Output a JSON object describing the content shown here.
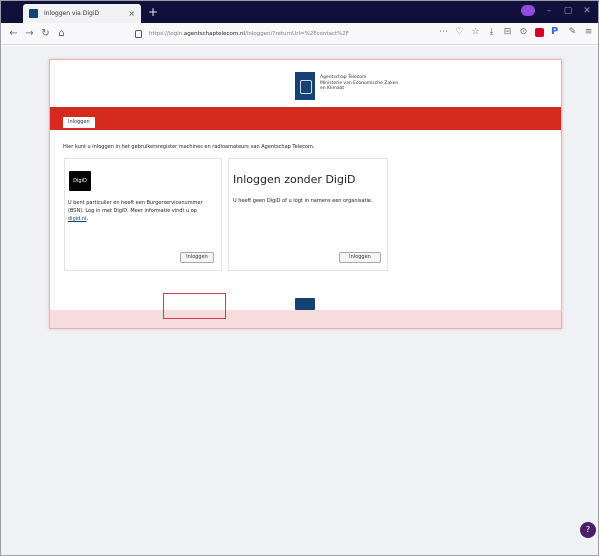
{
  "browser": {
    "tab_title": "Inloggen via DigiD",
    "tab_close": "×",
    "new_tab": "+",
    "url_prefix": "https://login.",
    "url_domain": "agentschaptelecom.nl",
    "url_path": "/inloggen/?returnUrl=%2Fcontact%2F",
    "nav": {
      "back": "←",
      "forward": "→",
      "reload": "↻",
      "home": "⌂"
    },
    "toolbar_icons": [
      "⋯",
      "♡",
      "☆",
      "⤓",
      "⊟",
      "⊙"
    ],
    "accent": "#8f4ddc"
  },
  "site": {
    "logo_text": "Agentschap Telecom\nMinisterie van Economische Zaken\nen Klimaat",
    "nav_tab": "Inloggen",
    "intro": "Hier kunt u inloggen in het gebruikersregister machines en radioamateurs van Agentschap Telecom.",
    "option1": {
      "logo": "DigiD",
      "description_before_link": "U bent particulier en heeft een Burgerservicenummer (BSN). Log in met DigiD. Meer informatie vindt u op ",
      "link": "digid.nl",
      "description_after_link": ".",
      "button": "Inloggen"
    },
    "option2": {
      "title": "Inloggen zonder DigiD",
      "description": "U heeft geen DigiD of u logt in namens een organisatie.",
      "button": "Inloggen"
    },
    "colors": {
      "brand_blue": "#154273",
      "brand_red": "#d52b1e"
    }
  },
  "chat_icon": "?"
}
